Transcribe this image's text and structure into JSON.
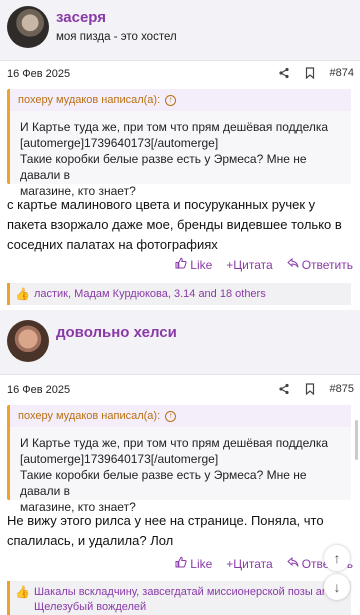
{
  "post1": {
    "username": "засеря",
    "user_title": "моя пизда - это хостел",
    "date": "16 Фев 2025",
    "number": "#874",
    "quote_author": "похеру мудаков написал(а):",
    "quote_text_line1": "И Картье туда же, при том что прям дешёвая подделка",
    "quote_text_line2": "[automerge]1739640173[/automerge]",
    "quote_text_line3": "Такие коробки белые разве есть у Эрмеса? Мне не давали в",
    "quote_text_line4": "магазине, кто знает?",
    "message_line1": "с картье малинового цвета и посуруканных ручек у",
    "message_line2": "пакета взоржало даже мое, бренды видевшее только в",
    "message_line3": "соседних палатах на фотографиях",
    "like_label": "Like",
    "quote_label": "+Цитата",
    "reply_label": "Ответить",
    "reactions": "ластик, Мадам Курдюкова, 3.14 and 18 others"
  },
  "post2": {
    "username": "довольно хелси",
    "date": "16 Фев 2025",
    "number": "#875",
    "quote_author": "похеру мудаков написал(а):",
    "quote_text_line1": "И Картье туда же, при том что прям дешёвая подделка",
    "quote_text_line2": "[automerge]1739640173[/automerge]",
    "quote_text_line3": "Такие коробки белые разве есть у Эрмеса? Мне не давали в",
    "quote_text_line4": "магазине, кто знает?",
    "message_line1": "Не вижу этого рилса у нее на странице. Поняла, что",
    "message_line2": "спалилась, и удалила? Лол",
    "like_label": "Like",
    "quote_label": "+Цитата",
    "reply_label": "Ответить",
    "reactions_line1": "Шакалы вскладчину, завсегдатай миссионерской позы and",
    "reactions_line2": "Щелезубый вожделей"
  },
  "colors": {
    "accent": "#8a3aa8",
    "quote_border": "#f0a12a",
    "background": "#f3f3f7"
  },
  "icons": [
    "share-icon",
    "bookmark-icon",
    "arrow-up-circle-icon",
    "like-icon",
    "reply-icon",
    "thumbs-up-icon",
    "scroll-up-icon",
    "scroll-down-icon"
  ]
}
